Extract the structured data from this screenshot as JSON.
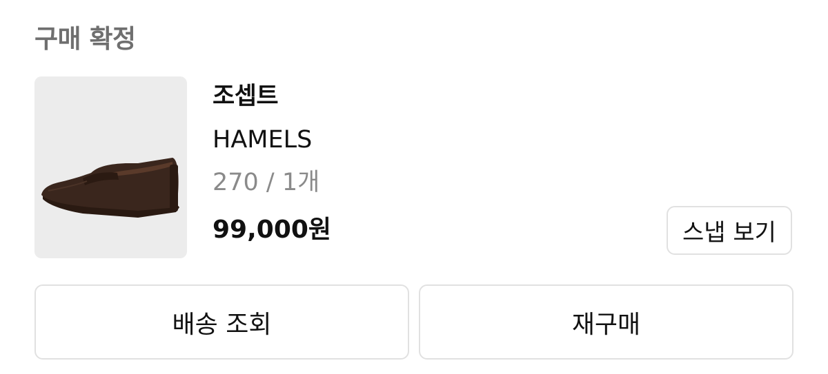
{
  "order": {
    "status": "구매 확정"
  },
  "product": {
    "image_icon": "loafer-shoe-icon",
    "brand": "조셉트",
    "name": "HAMELS",
    "option": "270 / 1개",
    "price": "99,000원"
  },
  "actions": {
    "snap_label": "스냅 보기",
    "track_label": "배송 조회",
    "rebuy_label": "재구매"
  },
  "colors": {
    "thumb_background": "#ececec",
    "shoe": "#3a261d",
    "border": "#e1e1e1",
    "muted_text": "#8a8a8a"
  }
}
